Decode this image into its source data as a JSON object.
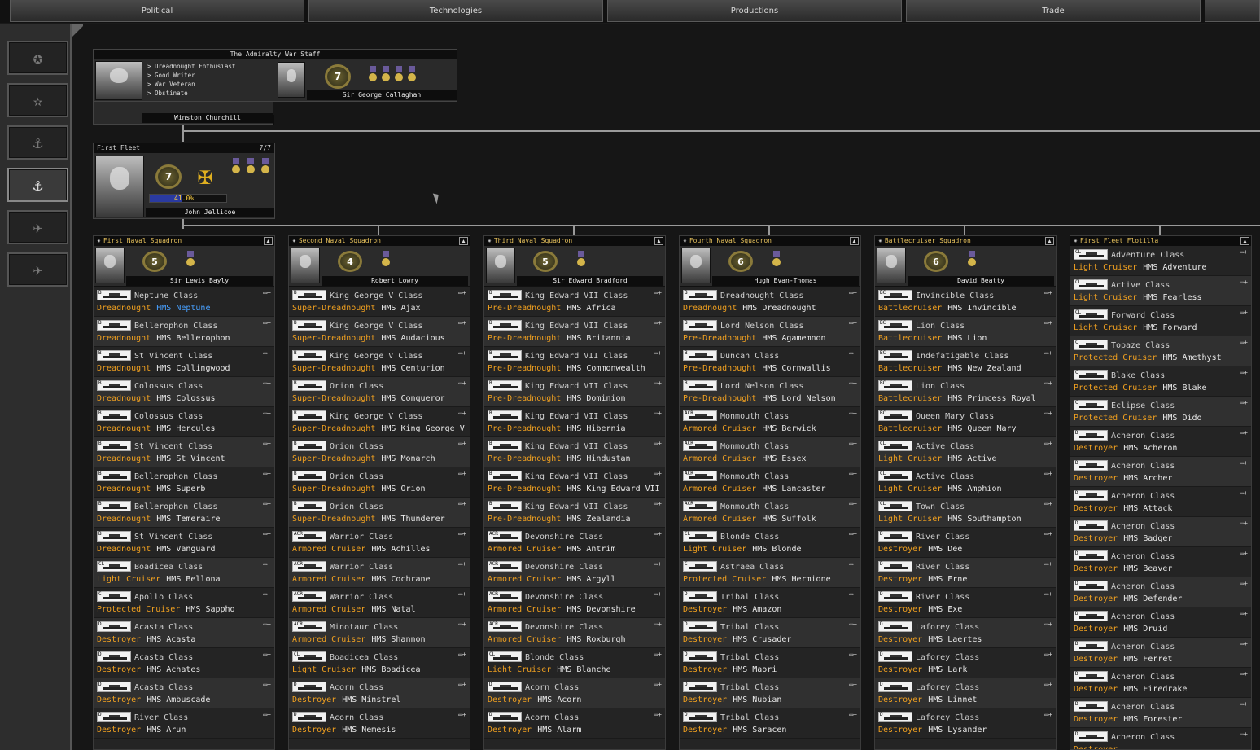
{
  "tabs": [
    "Political",
    "Technologies",
    "Productions",
    "Trade",
    ""
  ],
  "sidebar": {
    "buttons": [
      {
        "icon": "army-stars-icon"
      },
      {
        "icon": "army-star-icon"
      },
      {
        "icon": "anchor-person-icon"
      },
      {
        "icon": "anchor-icon"
      },
      {
        "icon": "wings-person-icon"
      },
      {
        "icon": "wings-icon"
      }
    ]
  },
  "admiralty": {
    "title": "The Admiralty War Staff",
    "minister_name": "Winston Churchill",
    "traits": [
      "> Dreadnought Enthusiast",
      "> Good Writer",
      "> War Veteran",
      "> Obstinate"
    ],
    "chief_name": "Sir George Callaghan",
    "chief_rank": "7"
  },
  "fleet": {
    "title": "First Fleet",
    "count": "7/7",
    "commander": "John Jellicoe",
    "rank": "7",
    "progress_text": "41.0%",
    "progress": 0.41
  },
  "columns": [
    {
      "title": "First Naval Squadron",
      "commander": "Sir Lewis Bayly",
      "rank": "5",
      "ships": [
        {
          "abbr": "B",
          "cls": "Neptune Class",
          "type": "Dreadnought",
          "name": "HMS Neptune",
          "hl": true
        },
        {
          "abbr": "B",
          "cls": "Bellerophon Class",
          "type": "Dreadnought",
          "name": "HMS Bellerophon"
        },
        {
          "abbr": "B",
          "cls": "St Vincent Class",
          "type": "Dreadnought",
          "name": "HMS Collingwood"
        },
        {
          "abbr": "B",
          "cls": "Colossus Class",
          "type": "Dreadnought",
          "name": "HMS Colossus"
        },
        {
          "abbr": "B",
          "cls": "Colossus Class",
          "type": "Dreadnought",
          "name": "HMS Hercules"
        },
        {
          "abbr": "B",
          "cls": "St Vincent Class",
          "type": "Dreadnought",
          "name": "HMS St Vincent"
        },
        {
          "abbr": "B",
          "cls": "Bellerophon Class",
          "type": "Dreadnought",
          "name": "HMS Superb"
        },
        {
          "abbr": "B",
          "cls": "Bellerophon Class",
          "type": "Dreadnought",
          "name": "HMS Temeraire"
        },
        {
          "abbr": "B",
          "cls": "St Vincent Class",
          "type": "Dreadnought",
          "name": "HMS Vanguard"
        },
        {
          "abbr": "CL",
          "cls": "Boadicea Class",
          "type": "Light Cruiser",
          "name": "HMS Bellona"
        },
        {
          "abbr": "C",
          "cls": "Apollo Class",
          "type": "Protected Cruiser",
          "name": "HMS Sappho"
        },
        {
          "abbr": "D",
          "cls": "Acasta Class",
          "type": "Destroyer",
          "name": "HMS Acasta"
        },
        {
          "abbr": "D",
          "cls": "Acasta Class",
          "type": "Destroyer",
          "name": "HMS Achates"
        },
        {
          "abbr": "D",
          "cls": "Acasta Class",
          "type": "Destroyer",
          "name": "HMS Ambuscade"
        },
        {
          "abbr": "D",
          "cls": "River Class",
          "type": "Destroyer",
          "name": "HMS Arun"
        }
      ]
    },
    {
      "title": "Second Naval Squadron",
      "commander": "Robert Lowry",
      "rank": "4",
      "ships": [
        {
          "abbr": "B",
          "cls": "King George V Class",
          "type": "Super-Dreadnought",
          "name": "HMS Ajax"
        },
        {
          "abbr": "B",
          "cls": "King George V Class",
          "type": "Super-Dreadnought",
          "name": "HMS Audacious"
        },
        {
          "abbr": "B",
          "cls": "King George V Class",
          "type": "Super-Dreadnought",
          "name": "HMS Centurion"
        },
        {
          "abbr": "B",
          "cls": "Orion Class",
          "type": "Super-Dreadnought",
          "name": "HMS Conqueror"
        },
        {
          "abbr": "B",
          "cls": "King George V Class",
          "type": "Super-Dreadnought",
          "name": "HMS King George V"
        },
        {
          "abbr": "B",
          "cls": "Orion Class",
          "type": "Super-Dreadnought",
          "name": "HMS Monarch"
        },
        {
          "abbr": "B",
          "cls": "Orion Class",
          "type": "Super-Dreadnought",
          "name": "HMS Orion"
        },
        {
          "abbr": "B",
          "cls": "Orion Class",
          "type": "Super-Dreadnought",
          "name": "HMS Thunderer"
        },
        {
          "abbr": "ACR",
          "cls": "Warrior Class",
          "type": "Armored Cruiser",
          "name": "HMS Achilles"
        },
        {
          "abbr": "ACR",
          "cls": "Warrior Class",
          "type": "Armored Cruiser",
          "name": "HMS Cochrane"
        },
        {
          "abbr": "ACR",
          "cls": "Warrior Class",
          "type": "Armored Cruiser",
          "name": "HMS Natal"
        },
        {
          "abbr": "ACR",
          "cls": "Minotaur Class",
          "type": "Armored Cruiser",
          "name": "HMS Shannon"
        },
        {
          "abbr": "CL",
          "cls": "Boadicea Class",
          "type": "Light Cruiser",
          "name": "HMS Boadicea"
        },
        {
          "abbr": "D",
          "cls": "Acorn Class",
          "type": "Destroyer",
          "name": "HMS Minstrel"
        },
        {
          "abbr": "D",
          "cls": "Acorn Class",
          "type": "Destroyer",
          "name": "HMS Nemesis"
        }
      ]
    },
    {
      "title": "Third Naval Squadron",
      "commander": "Sir Edward Bradford",
      "rank": "5",
      "ships": [
        {
          "abbr": "B",
          "cls": "King Edward VII Class",
          "type": "Pre-Dreadnought",
          "name": "HMS Africa"
        },
        {
          "abbr": "B",
          "cls": "King Edward VII Class",
          "type": "Pre-Dreadnought",
          "name": "HMS Britannia"
        },
        {
          "abbr": "B",
          "cls": "King Edward VII Class",
          "type": "Pre-Dreadnought",
          "name": "HMS Commonwealth"
        },
        {
          "abbr": "B",
          "cls": "King Edward VII Class",
          "type": "Pre-Dreadnought",
          "name": "HMS Dominion"
        },
        {
          "abbr": "B",
          "cls": "King Edward VII Class",
          "type": "Pre-Dreadnought",
          "name": "HMS Hibernia"
        },
        {
          "abbr": "B",
          "cls": "King Edward VII Class",
          "type": "Pre-Dreadnought",
          "name": "HMS Hindustan"
        },
        {
          "abbr": "B",
          "cls": "King Edward VII Class",
          "type": "Pre-Dreadnought",
          "name": "HMS King Edward VII"
        },
        {
          "abbr": "B",
          "cls": "King Edward VII Class",
          "type": "Pre-Dreadnought",
          "name": "HMS Zealandia"
        },
        {
          "abbr": "ACR",
          "cls": "Devonshire Class",
          "type": "Armored Cruiser",
          "name": "HMS Antrim"
        },
        {
          "abbr": "ACR",
          "cls": "Devonshire Class",
          "type": "Armored Cruiser",
          "name": "HMS Argyll"
        },
        {
          "abbr": "ACR",
          "cls": "Devonshire Class",
          "type": "Armored Cruiser",
          "name": "HMS Devonshire"
        },
        {
          "abbr": "ACR",
          "cls": "Devonshire Class",
          "type": "Armored Cruiser",
          "name": "HMS Roxburgh"
        },
        {
          "abbr": "CL",
          "cls": "Blonde Class",
          "type": "Light Cruiser",
          "name": "HMS Blanche"
        },
        {
          "abbr": "D",
          "cls": "Acorn Class",
          "type": "Destroyer",
          "name": "HMS Acorn"
        },
        {
          "abbr": "D",
          "cls": "Acorn Class",
          "type": "Destroyer",
          "name": "HMS Alarm"
        }
      ]
    },
    {
      "title": "Fourth Naval Squadron",
      "commander": "Hugh Evan-Thomas",
      "rank": "6",
      "ships": [
        {
          "abbr": "B",
          "cls": "Dreadnought Class",
          "type": "Dreadnought",
          "name": "HMS Dreadnought"
        },
        {
          "abbr": "B",
          "cls": "Lord Nelson Class",
          "type": "Pre-Dreadnought",
          "name": "HMS Agamemnon"
        },
        {
          "abbr": "B",
          "cls": "Duncan Class",
          "type": "Pre-Dreadnought",
          "name": "HMS Cornwallis"
        },
        {
          "abbr": "B",
          "cls": "Lord Nelson Class",
          "type": "Pre-Dreadnought",
          "name": "HMS Lord Nelson"
        },
        {
          "abbr": "ACR",
          "cls": "Monmouth Class",
          "type": "Armored Cruiser",
          "name": "HMS Berwick"
        },
        {
          "abbr": "ACR",
          "cls": "Monmouth Class",
          "type": "Armored Cruiser",
          "name": "HMS Essex"
        },
        {
          "abbr": "ACR",
          "cls": "Monmouth Class",
          "type": "Armored Cruiser",
          "name": "HMS Lancaster"
        },
        {
          "abbr": "ACR",
          "cls": "Monmouth Class",
          "type": "Armored Cruiser",
          "name": "HMS Suffolk"
        },
        {
          "abbr": "CL",
          "cls": "Blonde Class",
          "type": "Light Cruiser",
          "name": "HMS Blonde"
        },
        {
          "abbr": "C",
          "cls": "Astraea Class",
          "type": "Protected Cruiser",
          "name": "HMS Hermione"
        },
        {
          "abbr": "D",
          "cls": "Tribal Class",
          "type": "Destroyer",
          "name": "HMS Amazon"
        },
        {
          "abbr": "D",
          "cls": "Tribal Class",
          "type": "Destroyer",
          "name": "HMS Crusader"
        },
        {
          "abbr": "D",
          "cls": "Tribal Class",
          "type": "Destroyer",
          "name": "HMS Maori"
        },
        {
          "abbr": "D",
          "cls": "Tribal Class",
          "type": "Destroyer",
          "name": "HMS Nubian"
        },
        {
          "abbr": "D",
          "cls": "Tribal Class",
          "type": "Destroyer",
          "name": "HMS Saracen"
        }
      ]
    },
    {
      "title": "Battlecruiser Squadron",
      "commander": "David Beatty",
      "rank": "6",
      "ships": [
        {
          "abbr": "BC",
          "cls": "Invincible Class",
          "type": "Battlecruiser",
          "name": "HMS Invincible"
        },
        {
          "abbr": "BC",
          "cls": "Lion Class",
          "type": "Battlecruiser",
          "name": "HMS Lion"
        },
        {
          "abbr": "BC",
          "cls": "Indefatigable Class",
          "type": "Battlecruiser",
          "name": "HMS New Zealand"
        },
        {
          "abbr": "BC",
          "cls": "Lion Class",
          "type": "Battlecruiser",
          "name": "HMS Princess Royal"
        },
        {
          "abbr": "BC",
          "cls": "Queen Mary Class",
          "type": "Battlecruiser",
          "name": "HMS Queen Mary"
        },
        {
          "abbr": "CL",
          "cls": "Active Class",
          "type": "Light Cruiser",
          "name": "HMS Active"
        },
        {
          "abbr": "CL",
          "cls": "Active Class",
          "type": "Light Cruiser",
          "name": "HMS Amphion"
        },
        {
          "abbr": "CL",
          "cls": "Town Class",
          "type": "Light Cruiser",
          "name": "HMS Southampton"
        },
        {
          "abbr": "D",
          "cls": "River Class",
          "type": "Destroyer",
          "name": "HMS Dee"
        },
        {
          "abbr": "D",
          "cls": "River Class",
          "type": "Destroyer",
          "name": "HMS Erne"
        },
        {
          "abbr": "D",
          "cls": "River Class",
          "type": "Destroyer",
          "name": "HMS Exe"
        },
        {
          "abbr": "D",
          "cls": "Laforey Class",
          "type": "Destroyer",
          "name": "HMS Laertes"
        },
        {
          "abbr": "D",
          "cls": "Laforey Class",
          "type": "Destroyer",
          "name": "HMS Lark"
        },
        {
          "abbr": "D",
          "cls": "Laforey Class",
          "type": "Destroyer",
          "name": "HMS Linnet"
        },
        {
          "abbr": "D",
          "cls": "Laforey Class",
          "type": "Destroyer",
          "name": "HMS Lysander"
        }
      ]
    },
    {
      "title": "First Fleet Flotilla",
      "commander": "",
      "rank": "",
      "ships": [
        {
          "abbr": "CL",
          "cls": "Adventure Class",
          "type": "Light Cruiser",
          "name": "HMS Adventure"
        },
        {
          "abbr": "CL",
          "cls": "Active Class",
          "type": "Light Cruiser",
          "name": "HMS Fearless"
        },
        {
          "abbr": "CL",
          "cls": "Forward Class",
          "type": "Light Cruiser",
          "name": "HMS Forward"
        },
        {
          "abbr": "C",
          "cls": "Topaze Class",
          "type": "Protected Cruiser",
          "name": "HMS Amethyst"
        },
        {
          "abbr": "C",
          "cls": "Blake Class",
          "type": "Protected Cruiser",
          "name": "HMS Blake"
        },
        {
          "abbr": "C",
          "cls": "Eclipse Class",
          "type": "Protected Cruiser",
          "name": "HMS Dido"
        },
        {
          "abbr": "D",
          "cls": "Acheron Class",
          "type": "Destroyer",
          "name": "HMS Acheron"
        },
        {
          "abbr": "D",
          "cls": "Acheron Class",
          "type": "Destroyer",
          "name": "HMS Archer"
        },
        {
          "abbr": "D",
          "cls": "Acheron Class",
          "type": "Destroyer",
          "name": "HMS Attack"
        },
        {
          "abbr": "D",
          "cls": "Acheron Class",
          "type": "Destroyer",
          "name": "HMS Badger"
        },
        {
          "abbr": "D",
          "cls": "Acheron Class",
          "type": "Destroyer",
          "name": "HMS Beaver"
        },
        {
          "abbr": "D",
          "cls": "Acheron Class",
          "type": "Destroyer",
          "name": "HMS Defender"
        },
        {
          "abbr": "D",
          "cls": "Acheron Class",
          "type": "Destroyer",
          "name": "HMS Druid"
        },
        {
          "abbr": "D",
          "cls": "Acheron Class",
          "type": "Destroyer",
          "name": "HMS Ferret"
        },
        {
          "abbr": "D",
          "cls": "Acheron Class",
          "type": "Destroyer",
          "name": "HMS Firedrake"
        },
        {
          "abbr": "D",
          "cls": "Acheron Class",
          "type": "Destroyer",
          "name": "HMS Forester"
        },
        {
          "abbr": "D",
          "cls": "Acheron Class",
          "type": "Destroyer",
          "name": ""
        }
      ]
    }
  ],
  "colors": {
    "type": "#f0a020",
    "highlight": "#48a0ff",
    "header": "#e6c15c"
  }
}
